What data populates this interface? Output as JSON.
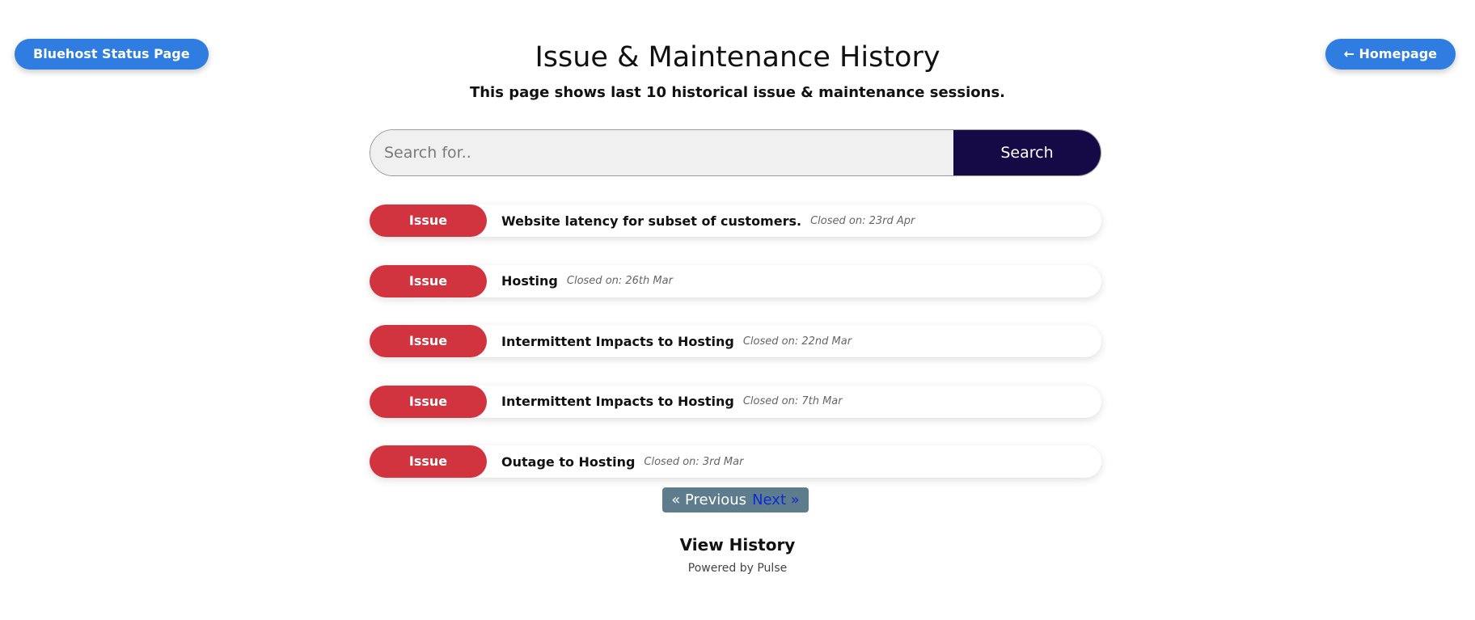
{
  "header": {
    "status_page_label": "Bluehost Status Page",
    "homepage_label": "← Homepage",
    "title": "Issue & Maintenance History",
    "subtitle": "This page shows last 10 historical issue & maintenance sessions."
  },
  "search": {
    "placeholder": "Search for..",
    "value": "",
    "button_label": "Search"
  },
  "issues": [
    {
      "badge": "Issue",
      "title": "Website latency for subset of customers.",
      "closed": "Closed on: 23rd Apr"
    },
    {
      "badge": "Issue",
      "title": "Hosting",
      "closed": "Closed on: 26th Mar"
    },
    {
      "badge": "Issue",
      "title": "Intermittent Impacts to Hosting",
      "closed": "Closed on: 22nd Mar"
    },
    {
      "badge": "Issue",
      "title": "Intermittent Impacts to Hosting",
      "closed": "Closed on: 7th Mar"
    },
    {
      "badge": "Issue",
      "title": "Outage to Hosting",
      "closed": "Closed on: 3rd Mar"
    }
  ],
  "pagination": {
    "previous_label": "« Previous",
    "next_label": "Next »"
  },
  "footer": {
    "view_history_label": "View History",
    "powered_by": "Powered by Pulse"
  },
  "colors": {
    "accent_blue": "#2f7de1",
    "search_button": "#150a45",
    "issue_badge": "#d1343f",
    "pagination_bg": "#5e7d8c",
    "next_link": "#0c2bd6"
  }
}
